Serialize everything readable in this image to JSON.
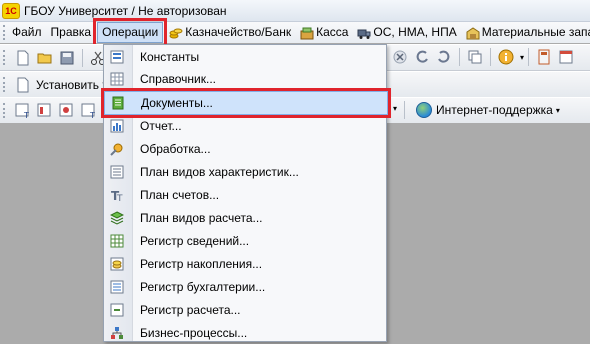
{
  "window": {
    "title": "ГБОУ Университет / Не авторизован",
    "logo_text": "1С"
  },
  "menubar": {
    "items": [
      {
        "name": "file",
        "label": "Файл"
      },
      {
        "name": "edit",
        "label": "Правка"
      },
      {
        "name": "operations",
        "label": "Операции",
        "active": true
      },
      {
        "name": "treasury",
        "label": "Казначейство/Банк",
        "icon": "coins-icon"
      },
      {
        "name": "cash",
        "label": "Касса",
        "icon": "cash-icon"
      },
      {
        "name": "assets",
        "label": "ОС, НМА, НПА",
        "icon": "truck-icon"
      },
      {
        "name": "materials",
        "label": "Материальные запасы",
        "icon": "warehouse-icon"
      }
    ]
  },
  "toolbar2": {
    "set_label": "Установить те"
  },
  "toolbar3": {
    "internet_label": "Интернет-поддержка"
  },
  "operations_menu": {
    "items": [
      {
        "label": "Константы",
        "icon": "constants-icon"
      },
      {
        "label": "Справочник...",
        "icon": "catalog-icon"
      },
      {
        "label": "Документы...",
        "icon": "documents-icon",
        "highlighted": true
      },
      {
        "label": "Отчет...",
        "icon": "report-icon"
      },
      {
        "label": "Обработка...",
        "icon": "processing-icon"
      },
      {
        "label": "План видов характеристик...",
        "icon": "characteristics-plan-icon"
      },
      {
        "label": "План счетов...",
        "icon": "chart-of-accounts-icon"
      },
      {
        "label": "План видов расчета...",
        "icon": "calculation-plan-icon"
      },
      {
        "label": "Регистр сведений...",
        "icon": "info-register-icon"
      },
      {
        "label": "Регистр накопления...",
        "icon": "accumulation-register-icon"
      },
      {
        "label": "Регистр бухгалтерии...",
        "icon": "accounting-register-icon"
      },
      {
        "label": "Регистр расчета...",
        "icon": "calculation-register-icon"
      },
      {
        "label": "Бизнес-процессы...",
        "icon": "business-process-icon"
      }
    ]
  },
  "colors": {
    "highlight_outline": "#e0242c",
    "menu_highlight": "#cfe3fb",
    "workspace": "#ababab"
  }
}
